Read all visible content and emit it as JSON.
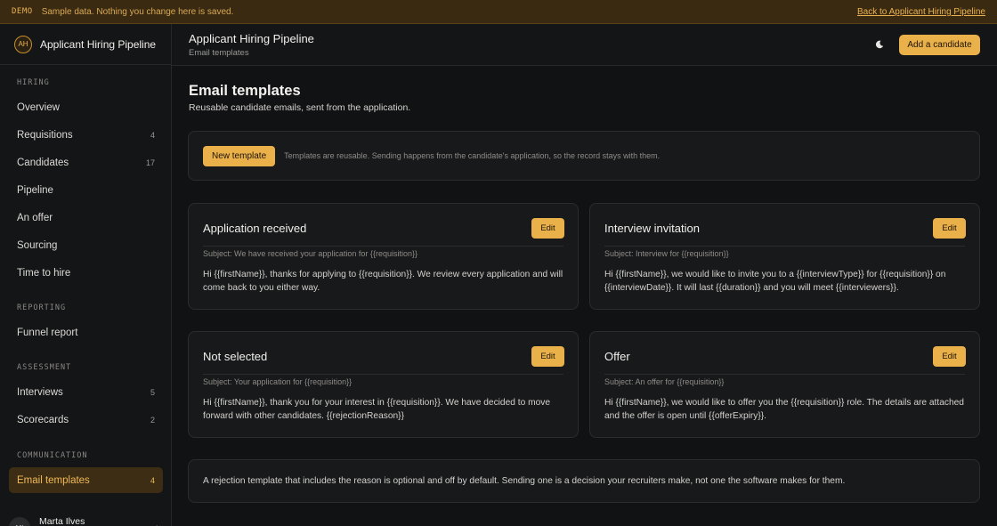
{
  "banner": {
    "tag": "DEMO",
    "message": "Sample data. Nothing you change here is saved.",
    "back_link": "Back to Applicant Hiring Pipeline"
  },
  "sidebar": {
    "brand_initials": "AH",
    "brand_name": "Applicant Hiring Pipeline",
    "sections": {
      "hiring": "HIRING",
      "reporting": "REPORTING",
      "assessment": "ASSESSMENT",
      "communication": "COMMUNICATION"
    },
    "items": [
      {
        "label": "Overview",
        "count": ""
      },
      {
        "label": "Requisitions",
        "count": "4"
      },
      {
        "label": "Candidates",
        "count": "17"
      },
      {
        "label": "Pipeline",
        "count": ""
      },
      {
        "label": "An offer",
        "count": ""
      },
      {
        "label": "Sourcing",
        "count": ""
      },
      {
        "label": "Time to hire",
        "count": ""
      },
      {
        "label": "Funnel report",
        "count": ""
      },
      {
        "label": "Interviews",
        "count": "5"
      },
      {
        "label": "Scorecards",
        "count": "2"
      },
      {
        "label": "Email templates",
        "count": "4"
      }
    ],
    "active_item": "Email templates",
    "user": {
      "initials": "MI",
      "name": "Marta Ilves"
    }
  },
  "topbar": {
    "title": "Applicant Hiring Pipeline",
    "breadcrumb": "Email templates",
    "theme_icon": "moon-icon",
    "add_button": "Add a candidate"
  },
  "main": {
    "title": "Email templates",
    "subtitle": "Reusable candidate emails, sent from the application.",
    "new_template_button": "New template",
    "notice": "Templates are reusable. Sending happens from the candidate's application, so the record stays with them.",
    "edit_label": "Edit",
    "templates": [
      {
        "name": "Application received",
        "subject": "Subject: We have received your application for {{requisition}}",
        "body": "Hi {{firstName}}, thanks for applying to {{requisition}}. We review every application and will come back to you either way."
      },
      {
        "name": "Interview invitation",
        "subject": "Subject: Interview for {{requisition}}",
        "body": "Hi {{firstName}}, we would like to invite you to a {{interviewType}} for {{requisition}} on {{interviewDate}}. It will last {{duration}} and you will meet {{interviewers}}."
      },
      {
        "name": "Not selected",
        "subject": "Subject: Your application for {{requisition}}",
        "body": "Hi {{firstName}}, thank you for your interest in {{requisition}}. We have decided to move forward with other candidates. {{rejectionReason}}"
      },
      {
        "name": "Offer",
        "subject": "Subject: An offer for {{requisition}}",
        "body": "Hi {{firstName}}, we would like to offer you the {{requisition}} role. The details are attached and the offer is open until {{offerExpiry}}."
      }
    ],
    "footnote": "A rejection template that includes the reason is optional and off by default. Sending one is a decision your recruiters make, not one the software makes for them."
  },
  "colors": {
    "accent": "#eab04a",
    "background": "#111213",
    "banner": "#3a2a12",
    "active_nav": "#3d2d14"
  }
}
